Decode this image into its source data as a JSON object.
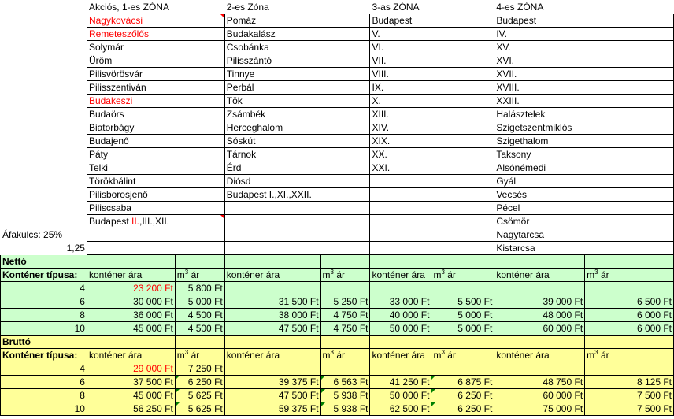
{
  "zones": {
    "h1": "Akciós, 1-es ZÓNA",
    "h2": "2-es Zóna",
    "h3": "3-as ZÓNA",
    "h4": "4-es ZÓNA",
    "rows": [
      [
        "Nagykovácsi",
        "Pomáz",
        "Budapest",
        "Budapest"
      ],
      [
        "Remeteszőlős",
        "Budakalász",
        "V.",
        "IV."
      ],
      [
        "Solymár",
        "Csobánka",
        "VI.",
        "XV."
      ],
      [
        "Üröm",
        "Pilisszántó",
        "VII.",
        "XVI."
      ],
      [
        "Pilisvörösvár",
        "Tinnye",
        "VIII.",
        "XVII."
      ],
      [
        "Pilisszentiván",
        "Perbál",
        "IX.",
        "XVIII."
      ],
      [
        "Budakeszi",
        "Tök",
        "X.",
        "XXIII."
      ],
      [
        "Budaörs",
        "Zsámbék",
        "XIII.",
        "Halásztelek"
      ],
      [
        "Biatorbágy",
        "Herceghalom",
        "XIV.",
        "Szigetszentmiklós"
      ],
      [
        "Budajenő",
        "Sóskút",
        "XIX.",
        "Szigethalom"
      ],
      [
        "Páty",
        "Tárnok",
        "XX.",
        "Taksony"
      ],
      [
        "Telki",
        "Érd",
        "XXI.",
        "Alsónémedi"
      ],
      [
        "Törökbálint",
        "Diósd",
        "",
        "Gyál"
      ],
      [
        "Pilisborosjenő",
        "Budapest I.,XI.,XXII.",
        "",
        "Vecsés"
      ],
      [
        "Piliscsaba",
        "",
        "",
        "Pécel"
      ],
      [
        "",
        "",
        "",
        "Csömör"
      ],
      [
        "",
        "",
        "",
        "Nagytarcsa"
      ],
      [
        "",
        "",
        "",
        " Kistarcsa"
      ]
    ],
    "last_zone1": {
      "a": "Budapest ",
      "b": "II.",
      "c": ",III.,XII."
    }
  },
  "vat": {
    "label": "Áfakulcs: 25%",
    "factor": "1,25"
  },
  "netto": {
    "title": "Nettó",
    "type_label": "Konténer típusa:",
    "col_price": "konténer ára",
    "col_m3_pre": "m",
    "col_m3_sup": "3",
    "col_m3_post": " ár",
    "rows": [
      {
        "size": "4",
        "z1": "23 200 Ft",
        "z1m": "5 800 Ft",
        "z2": "",
        "z2m": "",
        "z3": "",
        "z3m": "",
        "z4": "",
        "z4m": ""
      },
      {
        "size": "6",
        "z1": "30 000 Ft",
        "z1m": "5 000 Ft",
        "z2": "31 500 Ft",
        "z2m": "5 250 Ft",
        "z3": "33 000 Ft",
        "z3m": "5 500 Ft",
        "z4": "39 000 Ft",
        "z4m": "6 500 Ft"
      },
      {
        "size": "8",
        "z1": "36 000 Ft",
        "z1m": "4 500 Ft",
        "z2": "38 000 Ft",
        "z2m": "4 750 Ft",
        "z3": "40 000 Ft",
        "z3m": "5 000 Ft",
        "z4": "48 000 Ft",
        "z4m": "6 000 Ft"
      },
      {
        "size": "10",
        "z1": "45 000 Ft",
        "z1m": "4 500 Ft",
        "z2": "47 500 Ft",
        "z2m": "4 750 Ft",
        "z3": "50 000 Ft",
        "z3m": "5 000 Ft",
        "z4": "60 000 Ft",
        "z4m": "6 000 Ft"
      }
    ]
  },
  "brutto": {
    "title": "Bruttó",
    "type_label": "Konténer típusa:",
    "col_price": "konténer ára",
    "col_m3_pre": "m",
    "col_m3_sup": "3",
    "col_m3_post": " ár",
    "rows": [
      {
        "size": "4",
        "z1": "29 000 Ft",
        "z1m": "7 250 Ft",
        "z2": "",
        "z2m": "",
        "z3": "",
        "z3m": "",
        "z4": "",
        "z4m": ""
      },
      {
        "size": "6",
        "z1": "37 500 Ft",
        "z1m": "6 250 Ft",
        "z2": "39 375 Ft",
        "z2m": "6 563 Ft",
        "z3": "41 250 Ft",
        "z3m": "6 875 Ft",
        "z4": "48 750 Ft",
        "z4m": "8 125 Ft"
      },
      {
        "size": "8",
        "z1": "45 000 Ft",
        "z1m": "5 625 Ft",
        "z2": "47 500 Ft",
        "z2m": "5 938 Ft",
        "z3": "50 000 Ft",
        "z3m": "6 250 Ft",
        "z4": "60 000 Ft",
        "z4m": "7 500 Ft"
      },
      {
        "size": "10",
        "z1": "56 250 Ft",
        "z1m": "5 625 Ft",
        "z2": "59 375 Ft",
        "z2m": "5 938 Ft",
        "z3": "62 500 Ft",
        "z3m": "6 250 Ft",
        "z4": "75 000 Ft",
        "z4m": "7 500 Ft"
      }
    ]
  },
  "colors": {
    "netto_bg": "#ccffcc",
    "brutto_bg": "#ffff99",
    "highlight_text": "#ff0000",
    "grid": "#000000"
  }
}
